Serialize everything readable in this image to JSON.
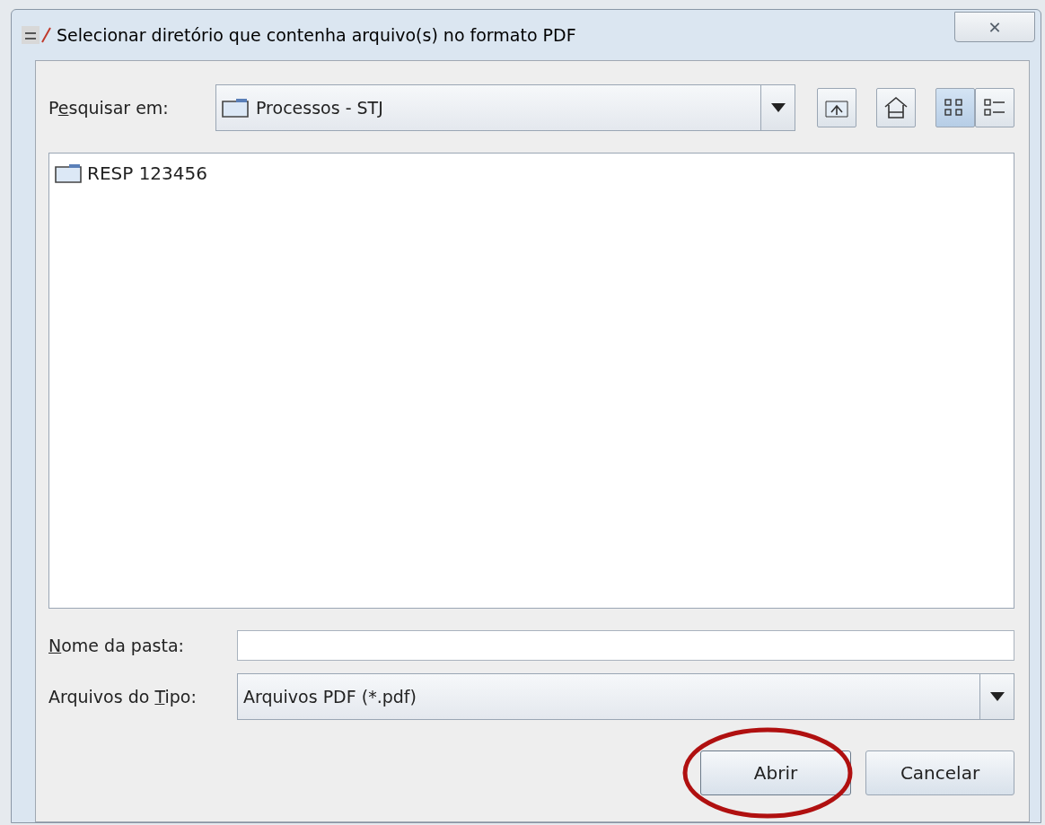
{
  "window": {
    "title": "Selecionar diretório que contenha arquivo(s) no formato PDF",
    "close_label": "✕"
  },
  "look_in": {
    "label": {
      "before": "P",
      "mnemonic": "e",
      "after": "squisar em:"
    },
    "value": "Processos - STJ"
  },
  "toolbar": [
    {
      "kind": "up",
      "selected": false
    },
    {
      "kind": "home",
      "selected": false
    },
    {
      "kind": "list",
      "selected": true
    },
    {
      "kind": "details",
      "selected": false
    }
  ],
  "files": [
    {
      "name": "RESP 123456",
      "selected": false
    }
  ],
  "folder_name": {
    "label": {
      "mnemonic": "N",
      "after": "ome da pasta:"
    }
  },
  "file_type": {
    "label": {
      "before": "Arquivos do ",
      "mnemonic": "T",
      "after": "ipo:"
    },
    "value": "Arquivos PDF (*.pdf)"
  },
  "buttons": [
    {
      "label": "Abrir",
      "highlighted": true
    },
    {
      "label": "Cancelar",
      "highlighted": false
    }
  ]
}
